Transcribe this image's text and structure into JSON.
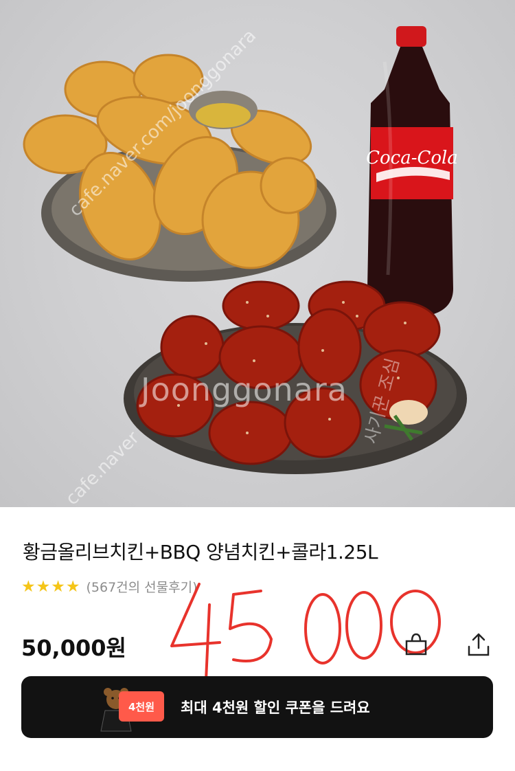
{
  "product": {
    "title": "황금올리브치킨+BBQ 양념치킨+콜라1.25L",
    "rating_stars": 4,
    "review_count": "(567건의 선물후기)",
    "price": "50,000원",
    "handwritten_price": "45000",
    "bottle_label": "Coca-Cola"
  },
  "watermarks": {
    "center": "Joonggonara",
    "diag1": "cafe.naver.com/joonggonara",
    "diag2": "cafe.naver",
    "korean": "사기꾼 조심"
  },
  "actions": {
    "gift_icon": "gift-bag-icon",
    "share_icon": "share-icon"
  },
  "coupon": {
    "tag": "4천원",
    "text": "최대 4천원 할인 쿠폰을 드려요"
  },
  "colors": {
    "star": "#f5c518",
    "coupon_bg": "#121212",
    "coupon_tag": "#ff5a4a",
    "handwriting": "#e8332c"
  }
}
